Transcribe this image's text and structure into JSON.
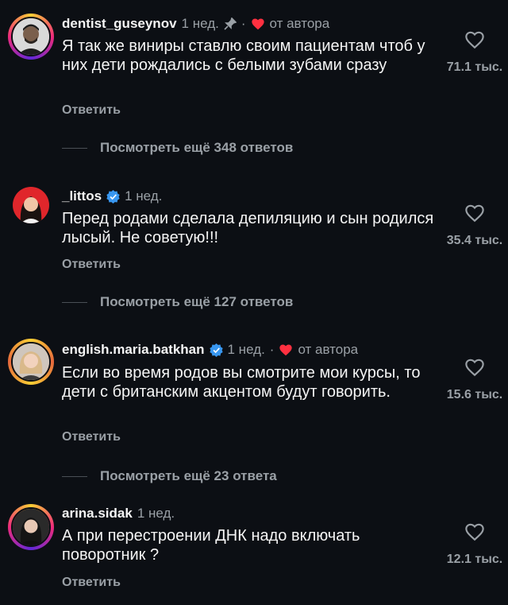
{
  "comments": [
    {
      "username": "dentist_guseynov",
      "time": "1 нед.",
      "pinned": true,
      "dot": "·",
      "author_like": "от автора",
      "text": "Я так же виниры ставлю своим пациентам чтоб у них дети рождались с белыми зубами сразу",
      "reply": "Ответить",
      "likes": "71.1 тыс.",
      "more_replies": "Посмотреть ещё 348 ответов",
      "avatar_icon": "man-portrait"
    },
    {
      "username": "_littos",
      "verified": true,
      "time": "1 нед.",
      "text": "Перед родами сделала депиляцию и сын родился лысый. Не советую!!!",
      "reply": "Ответить",
      "likes": "35.4 тыс.",
      "more_replies": "Посмотреть ещё 127 ответов",
      "avatar_icon": "woman-red-background"
    },
    {
      "username": "english.maria.batkhan",
      "verified": true,
      "time": "1 нед.",
      "dot": "·",
      "author_like": "от автора",
      "text": "Если во время родов вы смотрите мои курсы, то дети с британским акцентом будут говорить.",
      "reply": "Ответить",
      "likes": "15.6 тыс.",
      "more_replies": "Посмотреть ещё 23 ответа",
      "avatar_icon": "woman-blonde"
    },
    {
      "username": "arina.sidak",
      "time": "1 нед.",
      "text": "А при перестроении ДНК надо включать поворотник ?",
      "reply": "Ответить",
      "likes": "12.1 тыс.",
      "avatar_icon": "woman-dark"
    }
  ],
  "colors": {
    "background": "#0c0f14",
    "muted": "#9aa0a6",
    "heart_red": "#ff3040",
    "verified_blue": "#3897f0"
  }
}
